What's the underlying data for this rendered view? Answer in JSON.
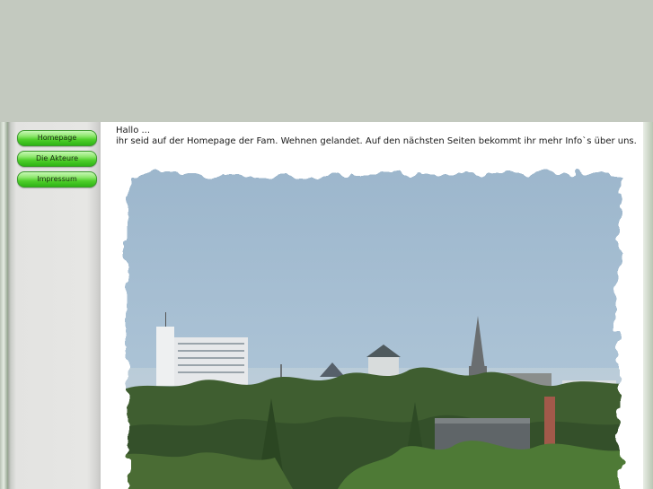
{
  "nav": {
    "items": [
      {
        "label": "Homepage"
      },
      {
        "label": "Die Akteure"
      },
      {
        "label": "Impressum"
      }
    ]
  },
  "content": {
    "greeting": "Hallo ...",
    "intro": "ihr seid auf der Homepage der Fam. Wehnen gelandet. Auf den nächsten Seiten bekommt ihr mehr Info`s über uns."
  },
  "photo": {
    "subject": "city-skyline-photo"
  },
  "colors": {
    "page_background": "#c3c9bf",
    "nav_button_green": "#4fcf2b",
    "sky": "#a9c3d8",
    "trees": "#3d5a2e"
  }
}
